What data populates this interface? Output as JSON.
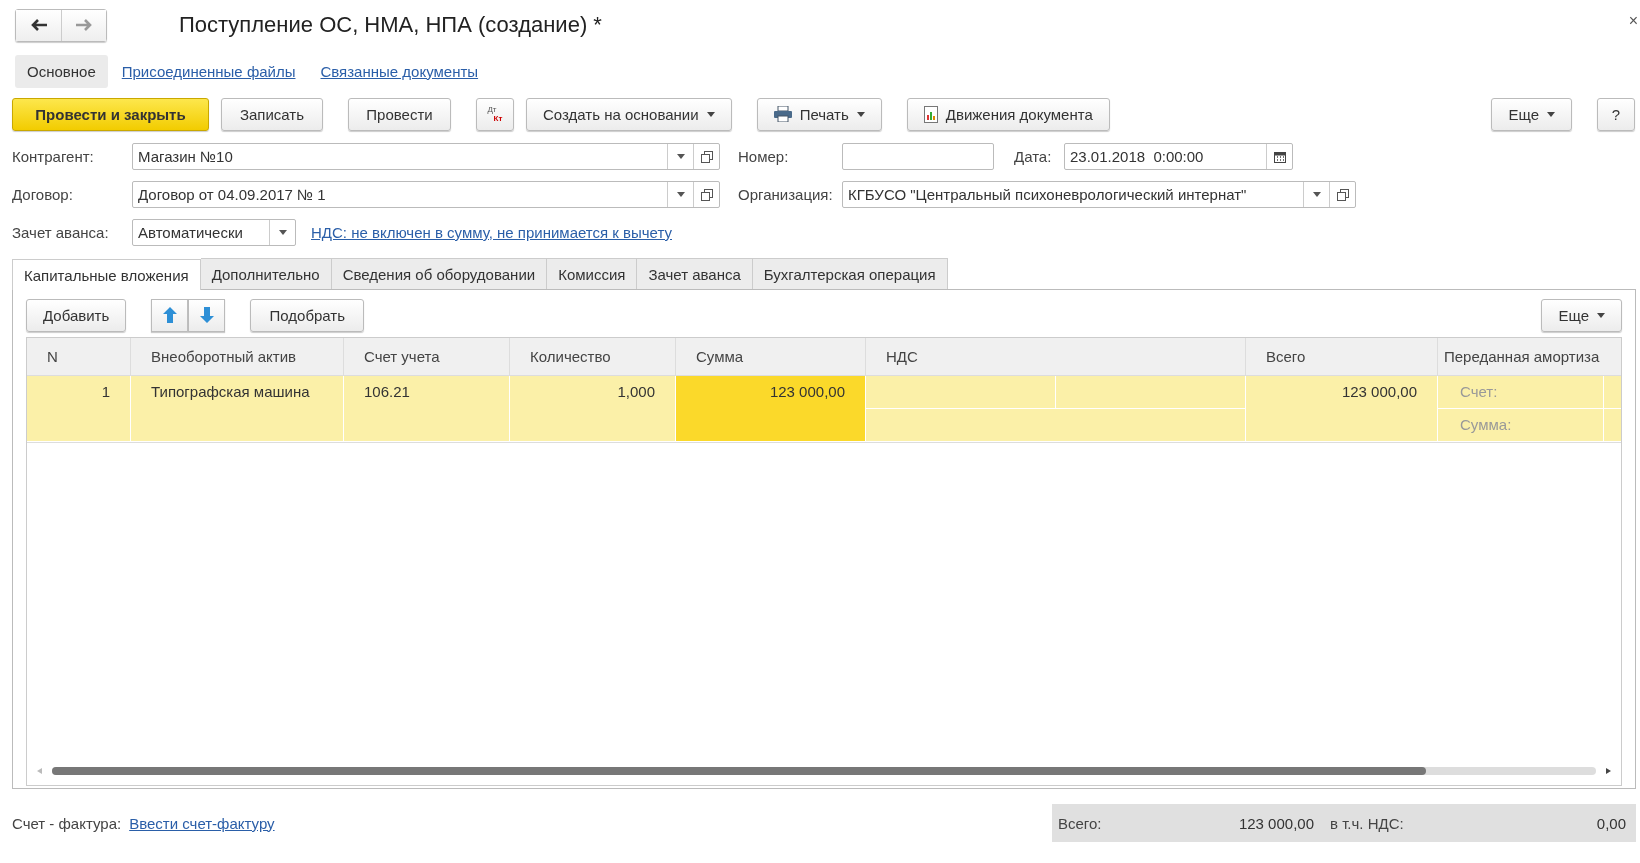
{
  "title": "Поступление ОС, НМА, НПА (создание) *",
  "close": "×",
  "sections": [
    {
      "label": "Основное",
      "selected": true
    },
    {
      "label": "Присоединенные файлы",
      "selected": false
    },
    {
      "label": "Связанные документы",
      "selected": false
    }
  ],
  "toolbar": [
    {
      "kind": "primary",
      "label": "Провести и закрыть"
    },
    {
      "kind": "button",
      "label": "Записать"
    },
    {
      "kind": "button",
      "label": "Провести"
    },
    {
      "kind": "dtkt",
      "label": "Дт",
      "label2": "Кт"
    },
    {
      "kind": "menu",
      "label": "Создать на основании"
    },
    {
      "kind": "print",
      "label": "Печать"
    },
    {
      "kind": "report",
      "label": "Движения документа"
    }
  ],
  "toolbar_right": [
    {
      "kind": "menu",
      "label": "Еще"
    },
    {
      "kind": "button",
      "label": "?"
    }
  ],
  "form": {
    "counterparty": {
      "label": "Контрагент:",
      "value": "Магазин №10"
    },
    "number": {
      "label": "Номер:"
    },
    "date": {
      "label": "Дата:",
      "value": "23.01.2018  0:00:00"
    },
    "contract": {
      "label": "Договор:",
      "value": "Договор от 04.09.2017 № 1"
    },
    "organization": {
      "label": "Организация:",
      "value": "КГБУСО \"Центральный психоневрологический интернат\""
    },
    "advance": {
      "label": "Зачет аванса:",
      "value": "Автоматически"
    },
    "vat_link": "НДС: не включен в сумму, не принимается к вычету"
  },
  "tabs": [
    {
      "label": "Капитальные вложения",
      "selected": true
    },
    {
      "label": "Дополнительно",
      "selected": false
    },
    {
      "label": "Сведения об оборудовании",
      "selected": false
    },
    {
      "label": "Комиссия",
      "selected": false
    },
    {
      "label": "Зачет аванса",
      "selected": false
    },
    {
      "label": "Бухгалтерская операция",
      "selected": false
    }
  ],
  "table_toolbar": {
    "add": "Добавить",
    "pick": "Подобрать",
    "more": "Еще"
  },
  "table": {
    "columns": [
      "N",
      "Внеоборотный актив",
      "Счет учета",
      "Количество",
      "Сумма",
      "НДС",
      "Всего",
      "Переданная амортиза"
    ],
    "rows": [
      {
        "selected": true,
        "n": "1",
        "asset": "Типографская машина",
        "account": "106.21",
        "quantity": "1,000",
        "amount": "123 000,00",
        "amount_selected": true,
        "total": "123 000,00",
        "dep_account_label": "Счет:",
        "dep_sum_label": "Сумма:"
      }
    ]
  },
  "footer": {
    "invoice_label": "Счет - фактура:",
    "invoice_link": "Ввести счет-фактуру",
    "total_label": "Всего:",
    "total": "123 000,00",
    "vat_label": "в т.ч. НДС:",
    "vat": "0,00"
  }
}
